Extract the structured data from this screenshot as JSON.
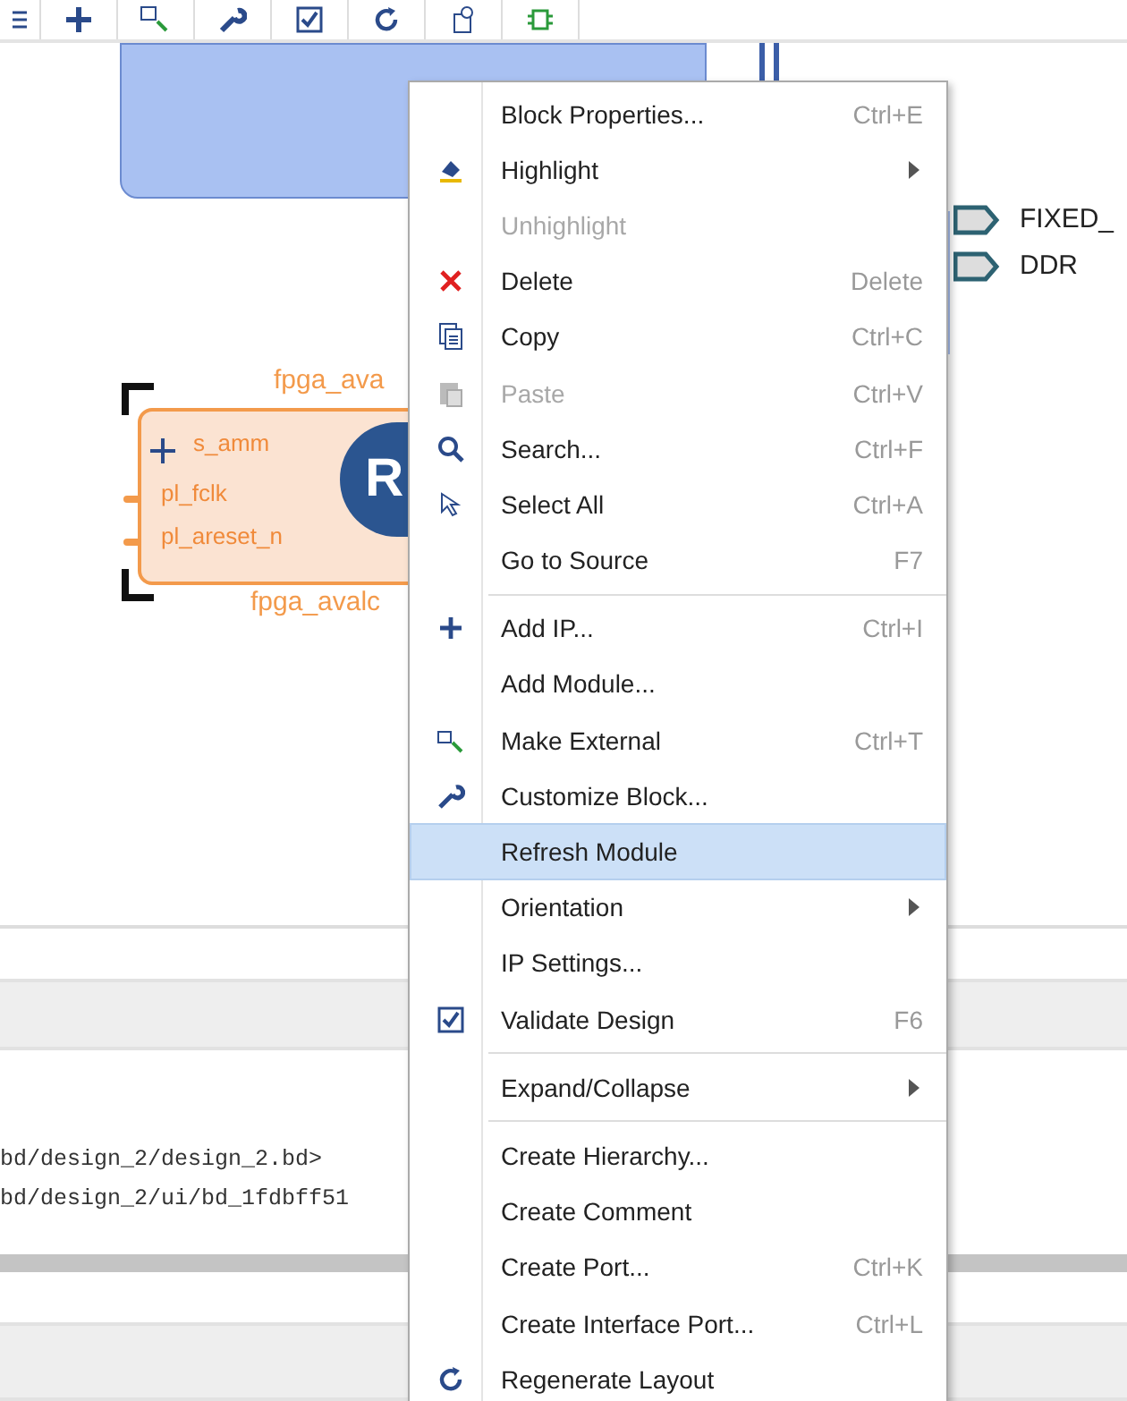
{
  "canvas": {
    "ports": [
      {
        "label": "FIXED_"
      },
      {
        "label": "DDR"
      }
    ],
    "ip_block": {
      "top_label": "fpga_ava",
      "bottom_label": "fpga_avalc",
      "logo_text": "R",
      "pins": [
        {
          "name": "s_amm",
          "kind": "bus"
        },
        {
          "name": "pl_fclk",
          "kind": "wire"
        },
        {
          "name": "pl_areset_n",
          "kind": "wire"
        }
      ]
    }
  },
  "console": {
    "lines": [
      "bd/design_2/design_2.bd>",
      "bd/design_2/ui/bd_1fdbff51"
    ]
  },
  "context_menu": [
    {
      "kind": "item",
      "label": "Block Properties...",
      "shortcut": "Ctrl+E",
      "disabled": false,
      "selected": false
    },
    {
      "kind": "submenu",
      "label": "Highlight",
      "disabled": false,
      "selected": false
    },
    {
      "kind": "item",
      "label": "Unhighlight",
      "disabled": true,
      "selected": false
    },
    {
      "kind": "item",
      "label": "Delete",
      "shortcut": "Delete",
      "disabled": false,
      "selected": false
    },
    {
      "kind": "item",
      "label": "Copy",
      "shortcut": "Ctrl+C",
      "disabled": false,
      "selected": false
    },
    {
      "kind": "item",
      "label": "Paste",
      "shortcut": "Ctrl+V",
      "disabled": true,
      "selected": false
    },
    {
      "kind": "item",
      "label": "Search...",
      "shortcut": "Ctrl+F",
      "disabled": false,
      "selected": false
    },
    {
      "kind": "item",
      "label": "Select All",
      "shortcut": "Ctrl+A",
      "disabled": false,
      "selected": false
    },
    {
      "kind": "item",
      "label": "Go to Source",
      "shortcut": "F7",
      "disabled": false,
      "selected": false
    },
    {
      "kind": "separator"
    },
    {
      "kind": "item",
      "label": "Add IP...",
      "shortcut": "Ctrl+I",
      "disabled": false,
      "selected": false
    },
    {
      "kind": "item",
      "label": "Add Module...",
      "disabled": false,
      "selected": false
    },
    {
      "kind": "item",
      "label": "Make External",
      "shortcut": "Ctrl+T",
      "disabled": false,
      "selected": false
    },
    {
      "kind": "item",
      "label": "Customize Block...",
      "disabled": false,
      "selected": false
    },
    {
      "kind": "item",
      "label": "Refresh Module",
      "disabled": false,
      "selected": true
    },
    {
      "kind": "submenu",
      "label": "Orientation",
      "disabled": false,
      "selected": false
    },
    {
      "kind": "item",
      "label": "IP Settings...",
      "disabled": false,
      "selected": false
    },
    {
      "kind": "item",
      "label": "Validate Design",
      "shortcut": "F6",
      "disabled": false,
      "selected": false
    },
    {
      "kind": "separator"
    },
    {
      "kind": "submenu",
      "label": "Expand/Collapse",
      "disabled": false,
      "selected": false
    },
    {
      "kind": "separator"
    },
    {
      "kind": "item",
      "label": "Create Hierarchy...",
      "disabled": false,
      "selected": false
    },
    {
      "kind": "item",
      "label": "Create Comment",
      "disabled": false,
      "selected": false
    },
    {
      "kind": "item",
      "label": "Create Port...",
      "shortcut": "Ctrl+K",
      "disabled": false,
      "selected": false
    },
    {
      "kind": "item",
      "label": "Create Interface Port...",
      "shortcut": "Ctrl+L",
      "disabled": false,
      "selected": false
    },
    {
      "kind": "item",
      "label": "Regenerate Layout",
      "disabled": false,
      "selected": false
    }
  ]
}
